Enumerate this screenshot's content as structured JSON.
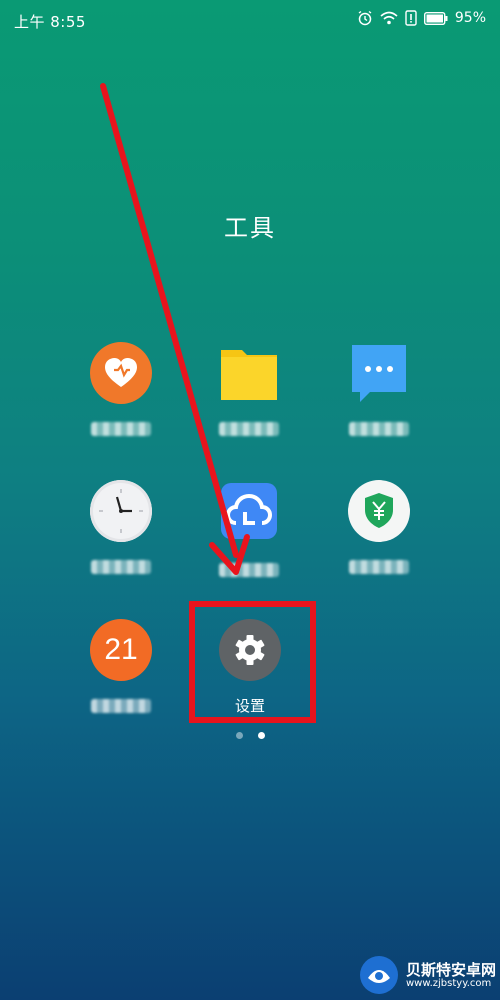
{
  "status_bar": {
    "time": "上午 8:55",
    "battery": "95%",
    "icons": [
      "alarm-icon",
      "wifi-icon",
      "sim-alert-icon",
      "battery-icon"
    ]
  },
  "folder": {
    "title": "工具",
    "apps": [
      {
        "icon": "health-heart-icon",
        "label": ""
      },
      {
        "icon": "folder-icon",
        "label": ""
      },
      {
        "icon": "message-icon",
        "label": ""
      },
      {
        "icon": "clock-icon",
        "label": ""
      },
      {
        "icon": "cloud-icon",
        "label": ""
      },
      {
        "icon": "yuan-shield-icon",
        "label": ""
      },
      {
        "icon": "calendar-icon",
        "label": "",
        "badge": "21"
      },
      {
        "icon": "gear-icon",
        "label": "设置"
      }
    ]
  },
  "pagination": {
    "pages": 2,
    "current": 2
  },
  "watermark": {
    "text": "贝斯特安卓网",
    "url": "www.zjbstyy.com"
  },
  "colors": {
    "highlight": "#e8141d",
    "settings_icon_bg": "#5f6366",
    "accent_orange": "#f26b25"
  }
}
